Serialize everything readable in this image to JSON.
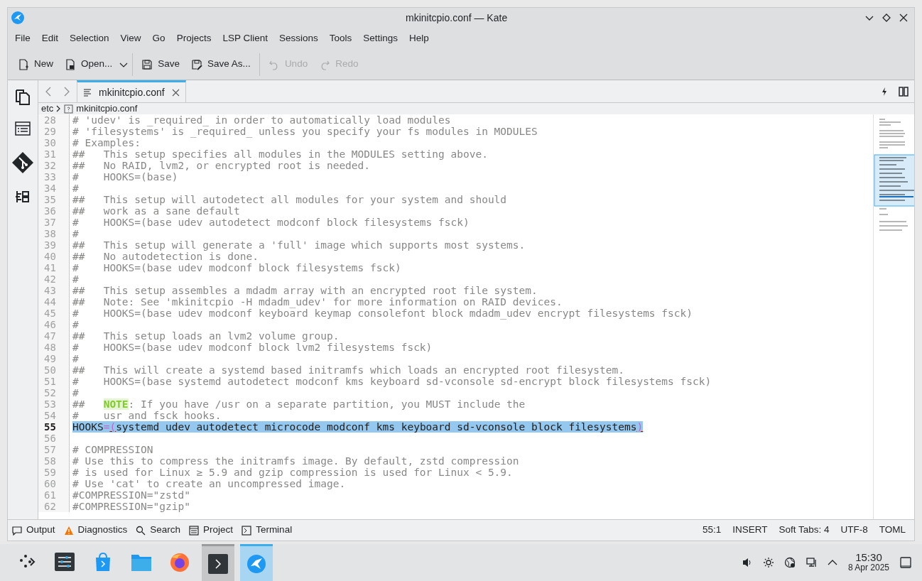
{
  "window": {
    "title": "mkinitcpio.conf — Kate"
  },
  "menu": [
    "File",
    "Edit",
    "Selection",
    "View",
    "Go",
    "Projects",
    "LSP Client",
    "Sessions",
    "Tools",
    "Settings",
    "Help"
  ],
  "toolbar": [
    {
      "kind": "new",
      "label": "New",
      "disabled": false
    },
    {
      "kind": "open",
      "label": "Open...",
      "disabled": false
    },
    {
      "kind": "save",
      "label": "Save",
      "disabled": false
    },
    {
      "kind": "saveas",
      "label": "Save As...",
      "disabled": false
    },
    {
      "kind": "undo",
      "label": "Undo",
      "disabled": true
    },
    {
      "kind": "redo",
      "label": "Redo",
      "disabled": true
    }
  ],
  "tabs": [
    {
      "label": "mkinitcpio.conf",
      "selected": true
    }
  ],
  "breadcrumb": [
    "etc",
    "mkinitcpio.conf"
  ],
  "editor": {
    "lines": [
      {
        "number": "28",
        "selected": false,
        "parts": [
          {
            "kind": "comment",
            "text": "# 'udev' is _required_ in order to automatically load modules"
          }
        ]
      },
      {
        "number": "29",
        "selected": false,
        "parts": [
          {
            "kind": "comment",
            "text": "# 'filesystems' is _required_ unless you specify your fs modules in MODULES"
          }
        ]
      },
      {
        "number": "30",
        "selected": false,
        "parts": [
          {
            "kind": "comment",
            "text": "# Examples:"
          }
        ]
      },
      {
        "number": "31",
        "selected": false,
        "parts": [
          {
            "kind": "comment",
            "text": "##   This setup specifies all modules in the MODULES setting above."
          }
        ]
      },
      {
        "number": "32",
        "selected": false,
        "parts": [
          {
            "kind": "comment",
            "text": "##   No RAID, lvm2, or encrypted root is needed."
          }
        ]
      },
      {
        "number": "33",
        "selected": false,
        "parts": [
          {
            "kind": "comment",
            "text": "#    HOOKS=(base)"
          }
        ]
      },
      {
        "number": "34",
        "selected": false,
        "parts": [
          {
            "kind": "comment",
            "text": "#"
          }
        ]
      },
      {
        "number": "35",
        "selected": false,
        "parts": [
          {
            "kind": "comment",
            "text": "##   This setup will autodetect all modules for your system and should"
          }
        ]
      },
      {
        "number": "36",
        "selected": false,
        "parts": [
          {
            "kind": "comment",
            "text": "##   work as a sane default"
          }
        ]
      },
      {
        "number": "37",
        "selected": false,
        "parts": [
          {
            "kind": "comment",
            "text": "#    HOOKS=(base udev autodetect modconf block filesystems fsck)"
          }
        ]
      },
      {
        "number": "38",
        "selected": false,
        "parts": [
          {
            "kind": "comment",
            "text": "#"
          }
        ]
      },
      {
        "number": "39",
        "selected": false,
        "parts": [
          {
            "kind": "comment",
            "text": "##   This setup will generate a 'full' image which supports most systems."
          }
        ]
      },
      {
        "number": "40",
        "selected": false,
        "parts": [
          {
            "kind": "comment",
            "text": "##   No autodetection is done."
          }
        ]
      },
      {
        "number": "41",
        "selected": false,
        "parts": [
          {
            "kind": "comment",
            "text": "#    HOOKS=(base udev modconf block filesystems fsck)"
          }
        ]
      },
      {
        "number": "42",
        "selected": false,
        "parts": [
          {
            "kind": "comment",
            "text": "#"
          }
        ]
      },
      {
        "number": "43",
        "selected": false,
        "parts": [
          {
            "kind": "comment",
            "text": "##   This setup assembles a mdadm array with an encrypted root file system."
          }
        ]
      },
      {
        "number": "44",
        "selected": false,
        "parts": [
          {
            "kind": "comment",
            "text": "##   Note: See 'mkinitcpio -H mdadm_udev' for more information on RAID devices."
          }
        ]
      },
      {
        "number": "45",
        "selected": false,
        "parts": [
          {
            "kind": "comment",
            "text": "#    HOOKS=(base udev modconf keyboard keymap consolefont block mdadm_udev encrypt filesystems fsck)"
          }
        ]
      },
      {
        "number": "46",
        "selected": false,
        "parts": [
          {
            "kind": "comment",
            "text": "#"
          }
        ]
      },
      {
        "number": "47",
        "selected": false,
        "parts": [
          {
            "kind": "comment",
            "text": "##   This setup loads an lvm2 volume group."
          }
        ]
      },
      {
        "number": "48",
        "selected": false,
        "parts": [
          {
            "kind": "comment",
            "text": "#    HOOKS=(base udev modconf block lvm2 filesystems fsck)"
          }
        ]
      },
      {
        "number": "49",
        "selected": false,
        "parts": [
          {
            "kind": "comment",
            "text": "#"
          }
        ]
      },
      {
        "number": "50",
        "selected": false,
        "parts": [
          {
            "kind": "comment",
            "text": "##   This will create a systemd based initramfs which loads an encrypted root filesystem."
          }
        ]
      },
      {
        "number": "51",
        "selected": false,
        "parts": [
          {
            "kind": "comment",
            "text": "#    HOOKS=(base systemd autodetect modconf kms keyboard sd-vconsole sd-encrypt block filesystems fsck)"
          }
        ]
      },
      {
        "number": "52",
        "selected": false,
        "parts": [
          {
            "kind": "comment",
            "text": "#"
          }
        ]
      },
      {
        "number": "53",
        "selected": false,
        "parts": [
          {
            "kind": "comment",
            "text": "##   "
          },
          {
            "kind": "alert",
            "text": "NOTE"
          },
          {
            "kind": "comment",
            "text": ": If you have /usr on a separate partition, you MUST include the"
          }
        ]
      },
      {
        "number": "54",
        "selected": false,
        "parts": [
          {
            "kind": "comment",
            "text": "#    usr and fsck hooks."
          }
        ]
      },
      {
        "number": "55",
        "selected": true,
        "parts": [
          {
            "kind": "code",
            "text": "HOOKS"
          },
          {
            "kind": "operator",
            "text": "="
          },
          {
            "kind": "bracket",
            "text": "("
          },
          {
            "kind": "code",
            "text": "systemd udev autodetect microcode modconf kms keyboard sd-vconsole block filesystems"
          },
          {
            "kind": "bracket",
            "text": ")"
          }
        ]
      },
      {
        "number": "56",
        "selected": false
      },
      {
        "number": "57",
        "selected": false,
        "parts": [
          {
            "kind": "comment",
            "text": "# COMPRESSION"
          }
        ]
      },
      {
        "number": "58",
        "selected": false,
        "parts": [
          {
            "kind": "comment",
            "text": "# Use this to compress the initramfs image. By default, zstd compression"
          }
        ]
      },
      {
        "number": "59",
        "selected": false,
        "parts": [
          {
            "kind": "comment",
            "text": "# is used for Linux ≥ 5.9 and gzip compression is used for Linux < 5.9."
          }
        ]
      },
      {
        "number": "60",
        "selected": false,
        "parts": [
          {
            "kind": "comment",
            "text": "# Use 'cat' to create an uncompressed image."
          }
        ]
      },
      {
        "number": "61",
        "selected": false,
        "parts": [
          {
            "kind": "comment",
            "text": "#COMPRESSION=\"zstd\""
          }
        ]
      },
      {
        "number": "62",
        "selected": false,
        "parts": [
          {
            "kind": "comment",
            "text": "#COMPRESSION=\"gzip\""
          }
        ]
      }
    ]
  },
  "status_bar": {
    "panels": [
      {
        "kind": "output",
        "label": "Output"
      },
      {
        "kind": "diagnostics",
        "label": "Diagnostics"
      },
      {
        "kind": "search",
        "label": "Search"
      },
      {
        "kind": "project",
        "label": "Project"
      },
      {
        "kind": "terminal",
        "label": "Terminal"
      }
    ],
    "info": [
      "55:1",
      "INSERT",
      "Soft Tabs: 4",
      "UTF-8",
      "TOML"
    ]
  },
  "taskbar": {
    "tasks": [
      {
        "kind": "launcher",
        "open": false,
        "selected": false
      },
      {
        "kind": "settings",
        "open": false,
        "selected": false
      },
      {
        "kind": "store",
        "open": false,
        "selected": false
      },
      {
        "kind": "files",
        "open": false,
        "selected": false
      },
      {
        "kind": "browser",
        "open": false,
        "selected": false
      },
      {
        "kind": "terminal",
        "open": true,
        "selected": false
      },
      {
        "kind": "editor",
        "open": true,
        "selected": true
      }
    ],
    "clock": {
      "time": "15:30",
      "date": "8 Apr 2025"
    }
  }
}
